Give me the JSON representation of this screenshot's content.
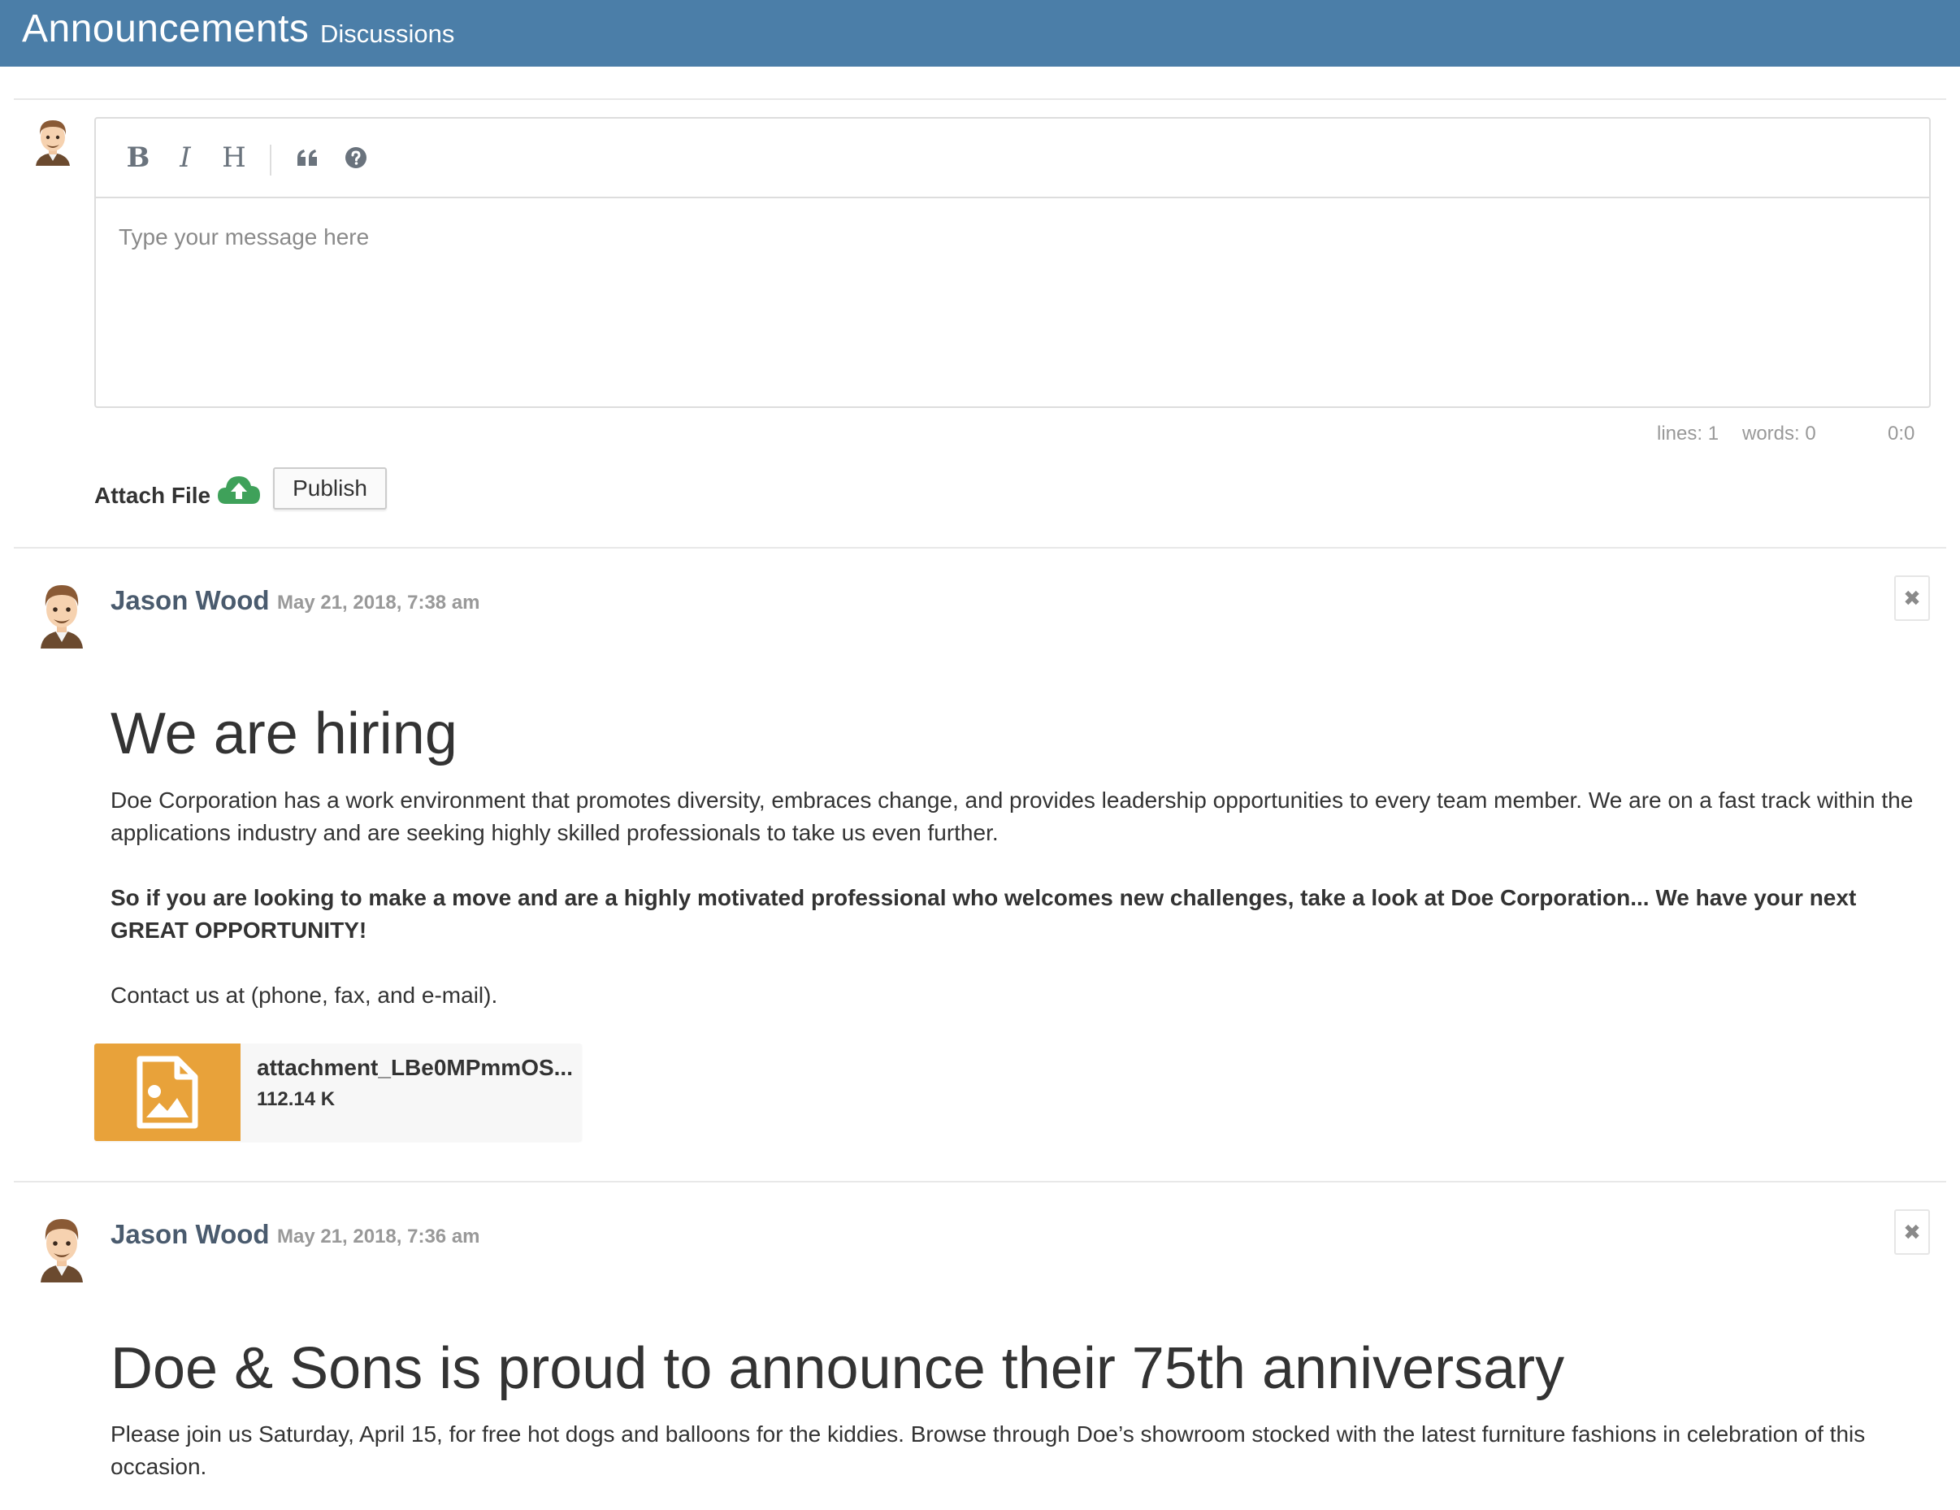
{
  "header": {
    "title": "Announcements",
    "tab": "Discussions"
  },
  "composer": {
    "toolbar": {
      "bold_label": "B",
      "italic_label": "I",
      "heading_label": "H",
      "quote_icon": "quote-icon",
      "help_icon": "help-icon"
    },
    "placeholder": "Type your message here",
    "status": {
      "lines": "lines: 1",
      "words": "words: 0",
      "cursor": "0:0"
    },
    "attach_label": "Attach File",
    "attach_icon": "cloud-upload-icon",
    "publish_label": "Publish"
  },
  "posts": [
    {
      "author": "Jason Wood",
      "date": "May 21, 2018, 7:38 am",
      "title": "We are hiring",
      "paragraphs": [
        "Doe Corporation has a work environment that promotes diversity, embraces change, and provides leadership opportunities to every team member. We are on a fast track within the applications industry and are seeking highly skilled professionals to take us even further.",
        "So if you are looking to make a move and are a highly motivated professional who welcomes new challenges, take a look at Doe Corporation... We have your next GREAT OPPORTUNITY!",
        "Contact us at (phone, fax, and e-mail)."
      ],
      "attachment": {
        "name": "attachment_LBe0MPmmOS...",
        "size": "112.14 K",
        "icon": "image-file-icon"
      }
    },
    {
      "author": "Jason Wood",
      "date": "May 21, 2018, 7:36 am",
      "title": "Doe & Sons is proud to announce their 75th anniversary",
      "paragraphs": [
        "Please join us Saturday, April 15, for free hot dogs and balloons for the kiddies. Browse through Doe’s showroom stocked with the latest furniture fashions in celebration of this occasion."
      ]
    }
  ],
  "colors": {
    "header_bg": "#4b7ea8",
    "attachment_thumb": "#e8a23a",
    "upload_icon": "#3fa15a"
  }
}
